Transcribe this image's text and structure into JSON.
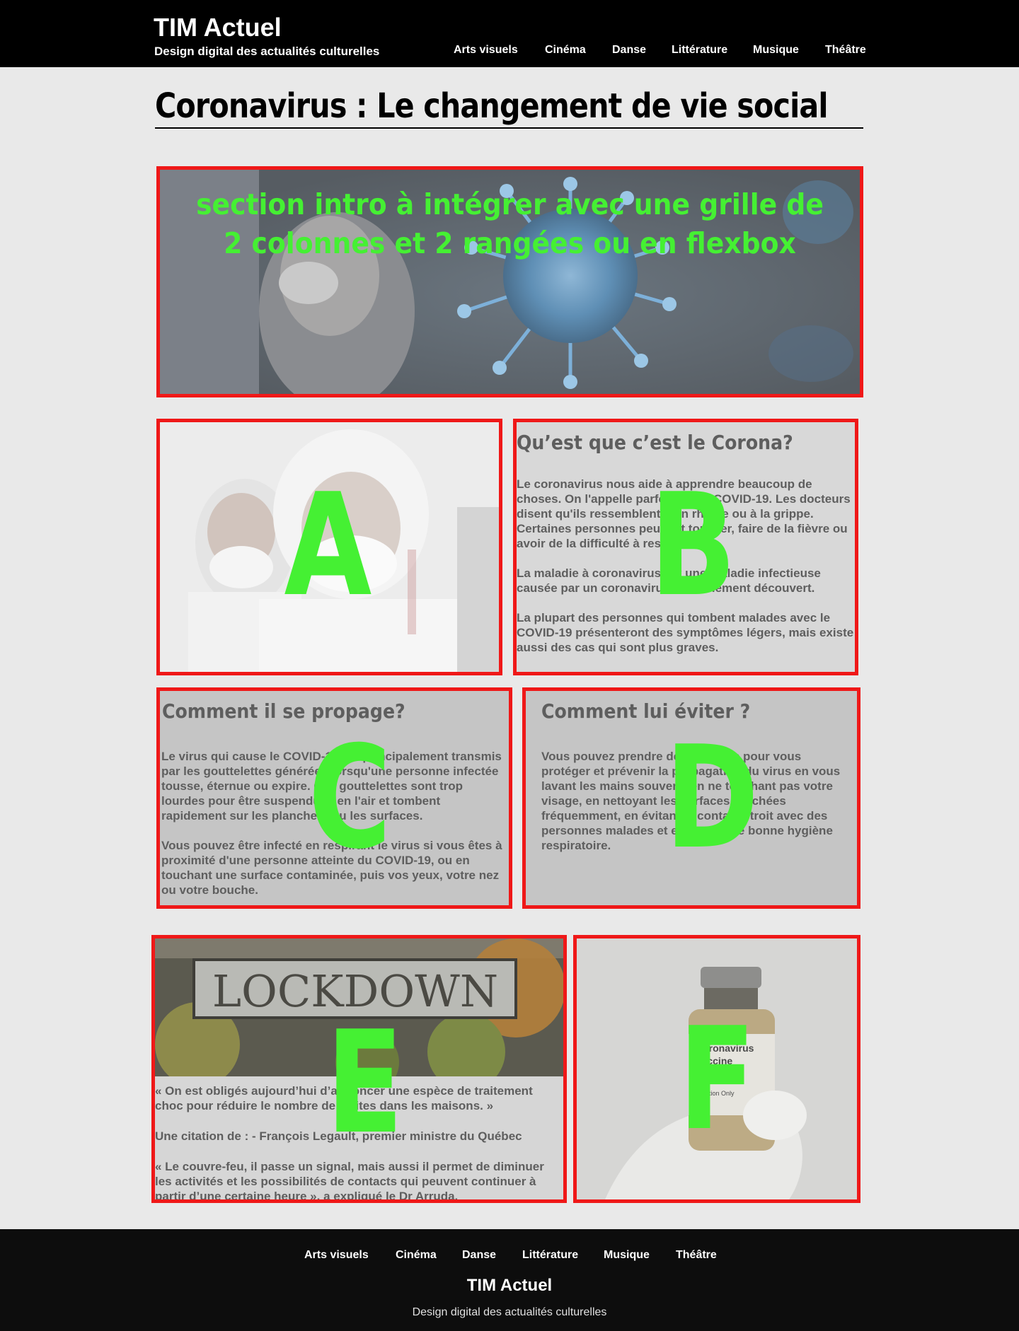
{
  "header": {
    "title": "TIM Actuel",
    "subtitle": "Design digital des actualités culturelles",
    "nav": [
      "Arts visuels",
      "Cinéma",
      "Danse",
      "Littérature",
      "Musique",
      "Théâtre"
    ]
  },
  "page": {
    "title": "Coronavirus : Le changement de vie social"
  },
  "intro": {
    "line1": "section intro à intégrer avec une grille de",
    "line2": "2 colonnes et 2 rangées ou en flexbox"
  },
  "labels": {
    "a": "A",
    "b": "B",
    "c": "C",
    "d": "D",
    "e": "E",
    "f": "F"
  },
  "section_b": {
    "title": "Qu’est que c’est le Corona?",
    "p1": "Le coronavirus nous aide à apprendre beaucoup de choses. On l'appelle parfois aussi COVID-19. Les docteurs disent qu'ils ressemblent à un rhume ou à la grippe. Certaines personnes peuvent tousser, faire de la fièvre ou avoir de la difficulté à respirer.",
    "p2": "La maladie à coronavirus est une maladie infectieuse causée par un coronavirus nouvellement découvert.",
    "p3": "La plupart des personnes qui tombent malades avec le COVID-19 présenteront des symptômes légers, mais existe aussi des cas qui sont plus graves."
  },
  "section_c": {
    "title": "Comment il se propage?",
    "p1": "Le virus qui cause le COVID-19 est principalement transmis par les gouttelettes générées lorsqu'une personne infectée tousse, éternue ou expire. Ces gouttelettes sont trop lourdes pour être suspendues en l'air et tombent rapidement sur les planchers ou les surfaces.",
    "p2": "Vous pouvez être infecté en respirant le virus si vous êtes à proximité d'une personne atteinte du COVID-19, ou en touchant une surface contaminée, puis vos yeux, votre nez ou votre bouche."
  },
  "section_d": {
    "title": "Comment lui éviter ?",
    "p1": "Vous pouvez prendre des mesures pour vous protéger et prévenir la propagation du virus en vous lavant les mains souvent, en ne touchant pas votre visage, en nettoyant les surfaces touchées fréquemment, en évitant le contact étroit avec des personnes malades et en ayant une bonne hygiène respiratoire."
  },
  "section_e": {
    "sign": "LOCKDOWN",
    "q1": "« On est obligés aujourd’hui d’annoncer une espèce de traitement choc pour réduire le nombre de visites dans les maisons. »",
    "cite": "Une citation de : - François Legault, premier ministre du Québec",
    "q2": "« Le couvre-feu, il passe un signal, mais aussi il permet de diminuer les activités et les possibilités de contacts qui peuvent continuer à partir d’une certaine heure », a expliqué le Dr Arruda."
  },
  "section_f": {
    "vial_line1": "Coronavirus",
    "vial_line2": "Vaccine",
    "vial_line3": "COVID-19",
    "vial_line4": "Injection Only"
  },
  "footer": {
    "nav": [
      "Arts visuels",
      "Cinéma",
      "Danse",
      "Littérature",
      "Musique",
      "Théâtre"
    ],
    "title": "TIM Actuel",
    "subtitle": "Design digital des actualités culturelles"
  },
  "colors": {
    "accent_red": "#ef1818",
    "overlay_green": "#45f033",
    "header_bg": "#000000",
    "page_bg": "#e9e9e9"
  }
}
